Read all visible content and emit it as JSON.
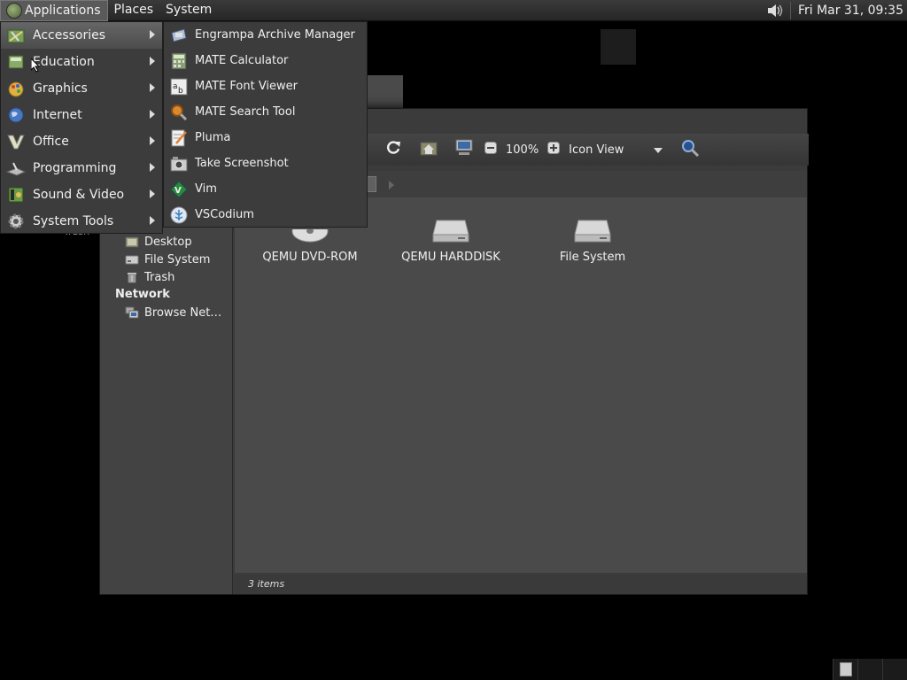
{
  "top_panel": {
    "menus": [
      "Applications",
      "Places",
      "System"
    ],
    "clock": "Fri Mar 31, 09:35"
  },
  "apps_menu": {
    "items": [
      {
        "label": "Accessories",
        "icon": "accessories-icon"
      },
      {
        "label": "Education",
        "icon": "education-icon"
      },
      {
        "label": "Graphics",
        "icon": "graphics-icon"
      },
      {
        "label": "Internet",
        "icon": "internet-globe-icon"
      },
      {
        "label": "Office",
        "icon": "office-icon"
      },
      {
        "label": "Programming",
        "icon": "programming-icon"
      },
      {
        "label": "Sound & Video",
        "icon": "sound-video-icon"
      },
      {
        "label": "System Tools",
        "icon": "gear-icon"
      }
    ]
  },
  "accessories_menu": {
    "items": [
      {
        "label": "Engrampa Archive Manager",
        "icon": "archive-icon"
      },
      {
        "label": "MATE Calculator",
        "icon": "calculator-icon"
      },
      {
        "label": "MATE Font Viewer",
        "icon": "font-icon"
      },
      {
        "label": "MATE Search Tool",
        "icon": "search-icon"
      },
      {
        "label": "Pluma",
        "icon": "text-editor-icon"
      },
      {
        "label": "Take Screenshot",
        "icon": "camera-icon"
      },
      {
        "label": "Vim",
        "icon": "vim-icon"
      },
      {
        "label": "VSCodium",
        "icon": "vscodium-icon"
      }
    ]
  },
  "desktop": {
    "trash_label": "Trash"
  },
  "file_manager": {
    "zoom": "100%",
    "view_mode": "Icon View",
    "sidebar": {
      "places": [
        {
          "label": "Desktop",
          "icon": "desktop-icon"
        },
        {
          "label": "File System",
          "icon": "drive-icon"
        },
        {
          "label": "Trash",
          "icon": "trash-icon"
        }
      ],
      "network_heading": "Network",
      "network": [
        {
          "label": "Browse Net…",
          "icon": "network-icon"
        }
      ]
    },
    "files": [
      {
        "label": "QEMU DVD-ROM",
        "icon": "optical-drive-icon"
      },
      {
        "label": "QEMU HARDDISK",
        "icon": "harddisk-icon"
      },
      {
        "label": "File System",
        "icon": "harddisk-icon"
      }
    ],
    "status": "3 items"
  }
}
